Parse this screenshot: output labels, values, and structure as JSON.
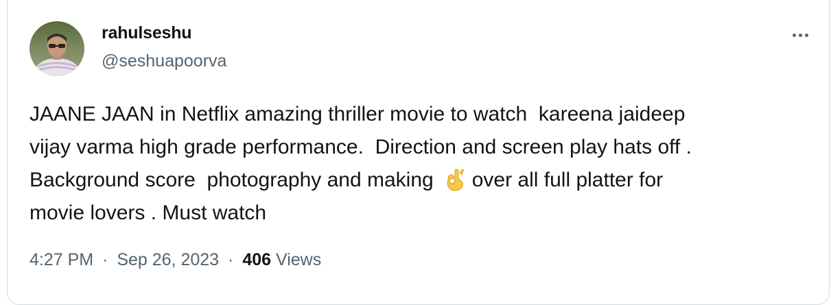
{
  "user": {
    "display_name": "rahulseshu",
    "handle": "@seshuapoorva"
  },
  "tweet": {
    "lines": [
      "JAANE JAAN in Netflix amazing thriller movie to watch  kareena jaideep",
      "vijay varma high grade performance.  Direction and screen play hats off .",
      "Background score  photography and making",
      "over all full platter for",
      "movie lovers . Must watch"
    ],
    "emoji": "ok-hand-emoji"
  },
  "meta": {
    "time": "4:27 PM",
    "separator": "·",
    "date": "Sep 26, 2023",
    "views_count": "406",
    "views_label": "Views"
  },
  "colors": {
    "text_primary": "#0f1419",
    "text_secondary": "#536471",
    "border": "#cfd9de"
  }
}
